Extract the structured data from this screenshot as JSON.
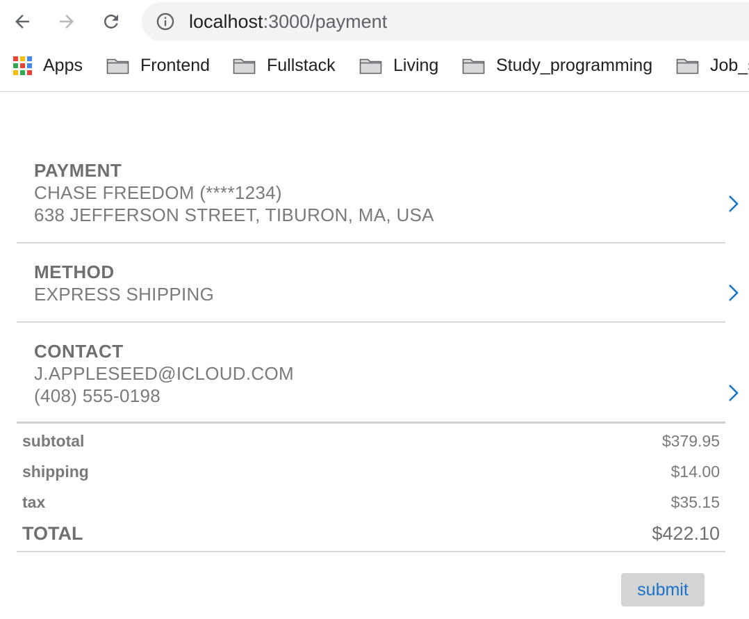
{
  "browser": {
    "url_host": "localhost",
    "url_path": ":3000/payment",
    "bookmarks": [
      {
        "label": "Apps",
        "icon": "apps-grid-icon"
      },
      {
        "label": "Frontend",
        "icon": "folder-icon"
      },
      {
        "label": "Fullstack",
        "icon": "folder-icon"
      },
      {
        "label": "Living",
        "icon": "folder-icon"
      },
      {
        "label": "Study_programming",
        "icon": "folder-icon"
      },
      {
        "label": "Job_s",
        "icon": "folder-icon"
      }
    ]
  },
  "sections": {
    "payment": {
      "title": "PAYMENT",
      "lines": [
        "CHASE FREEDOM (****1234)",
        "638 JEFFERSON STREET, TIBURON, MA, USA"
      ]
    },
    "method": {
      "title": "METHOD",
      "lines": [
        "EXPRESS SHIPPING"
      ]
    },
    "contact": {
      "title": "CONTACT",
      "lines": [
        "J.APPLESEED@ICLOUD.COM",
        "(408) 555-0198"
      ]
    }
  },
  "summary": {
    "subtotal": {
      "label": "subtotal",
      "value": "$379.95"
    },
    "shipping": {
      "label": "shipping",
      "value": "$14.00"
    },
    "tax": {
      "label": "tax",
      "value": "$35.15"
    },
    "total": {
      "label": "TOTAL",
      "value": "$422.10"
    }
  },
  "actions": {
    "submit_label": "submit"
  },
  "colors": {
    "accent": "#1a73c8",
    "text_muted": "#7a7a7a",
    "divider": "#d8d8d8"
  }
}
